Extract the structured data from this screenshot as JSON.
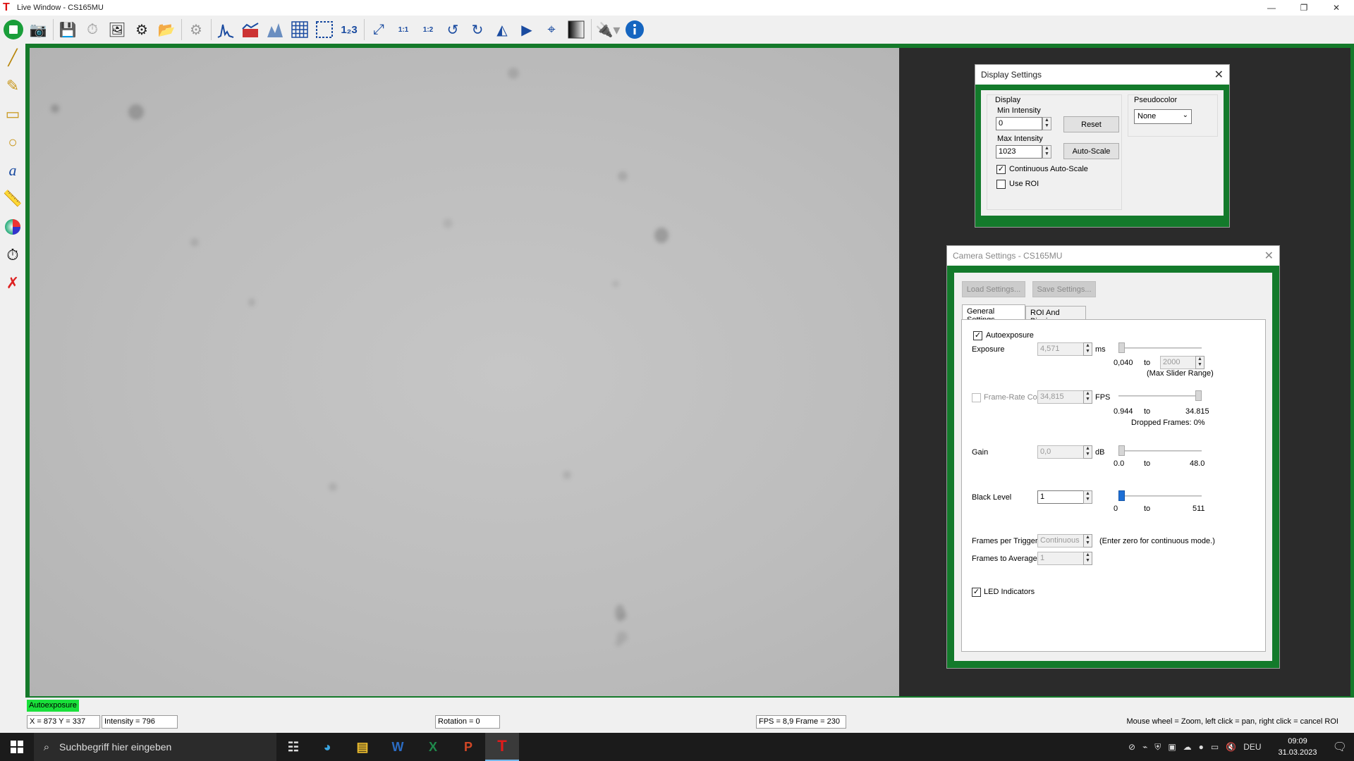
{
  "window": {
    "title": "Live Window - CS165MU",
    "app_icon": "T"
  },
  "toolbar": {
    "icons": [
      "start-stop-icon",
      "snapshot-icon",
      "record-icon",
      "timed-series-icon",
      "save-image-icon",
      "save-settings-icon",
      "open-folder-icon",
      "camera-settings-icon",
      "histogram-icon",
      "line-profile-icon",
      "3d-profile-icon",
      "grid-icon",
      "roi-select-icon",
      "numbering-icon",
      "fit-to-window-icon",
      "zoom-1-1-icon",
      "zoom-1-2-icon",
      "rotate-ccw-icon",
      "rotate-cw-icon",
      "flip-horizontal-icon",
      "flip-vertical-icon",
      "crosshair-icon",
      "grayscale-icon",
      "plugin-icon",
      "info-icon"
    ],
    "zoom_1_1": "1:1",
    "zoom_1_2": "1:2",
    "numbering": "1₂3"
  },
  "left_tools": [
    "line-tool-icon",
    "pencil-tool-icon",
    "rectangle-tool-icon",
    "circle-tool-icon",
    "text-tool-icon",
    "ruler-tool-icon",
    "color-wheel-icon",
    "stopwatch-icon",
    "clear-annotations-icon"
  ],
  "display_settings": {
    "title": "Display Settings",
    "display_group": "Display",
    "min_intensity_label": "Min Intensity",
    "min_intensity_value": "0",
    "reset_label": "Reset",
    "max_intensity_label": "Max Intensity",
    "max_intensity_value": "1023",
    "autoscale_label": "Auto-Scale",
    "continuous_autoscale_label": "Continuous Auto-Scale",
    "continuous_autoscale_checked": true,
    "use_roi_label": "Use ROI",
    "use_roi_checked": false,
    "pseudocolor_label": "Pseudocolor",
    "pseudocolor_value": "None"
  },
  "camera_settings": {
    "title": "Camera Settings - CS165MU",
    "load_settings": "Load Settings...",
    "save_settings": "Save Settings...",
    "tabs": [
      "General Settings",
      "ROI And Binning"
    ],
    "autoexposure_label": "Autoexposure",
    "autoexposure_checked": true,
    "exposure_label": "Exposure",
    "exposure_value": "4,571",
    "exposure_unit": "ms",
    "exposure_min": "0,040",
    "exposure_to": "to",
    "exposure_max": "2000",
    "max_slider_range": "(Max Slider Range)",
    "framerate_label": "Frame-Rate Control",
    "framerate_checked": false,
    "framerate_value": "34,815",
    "framerate_unit": "FPS",
    "framerate_min": "0.944",
    "framerate_to": "to",
    "framerate_max": "34.815",
    "dropped_frames": "Dropped Frames: 0%",
    "gain_label": "Gain",
    "gain_value": "0,0",
    "gain_unit": "dB",
    "gain_min": "0.0",
    "gain_to": "to",
    "gain_max": "48.0",
    "black_level_label": "Black Level",
    "black_level_value": "1",
    "black_min": "0",
    "black_to": "to",
    "black_max": "511",
    "frames_per_trigger_label": "Frames per Trigger",
    "frames_per_trigger_value": "Continuous",
    "frames_per_trigger_hint": "(Enter zero for continuous mode.)",
    "frames_to_average_label": "Frames to Average",
    "frames_to_average_value": "1",
    "led_indicators_label": "LED Indicators",
    "led_indicators_checked": true,
    "exposure_slider_fraction": 0.0,
    "framerate_slider_fraction": 1.0,
    "gain_slider_fraction": 0.0,
    "black_slider_fraction": 0.0
  },
  "status": {
    "badge": "Autoexposure",
    "coords": "X = 873  Y = 337",
    "intensity": "Intensity = 796",
    "rotation": "Rotation = 0",
    "fps_frame": "FPS = 8,9  Frame = 230",
    "hint": "Mouse wheel = Zoom, left click = pan, right click = cancel ROI"
  },
  "taskbar": {
    "search_placeholder": "Suchbegriff hier eingeben",
    "apps": [
      "task-view-icon",
      "edge-icon",
      "file-explorer-icon",
      "word-icon",
      "excel-icon",
      "powerpoint-icon",
      "thorcam-icon"
    ],
    "language": "DEU",
    "time": "09:09",
    "date": "31.03.2023"
  },
  "colors": {
    "frame_green": "#137a2b",
    "badge_green": "#19e03a",
    "accent_blue": "#1a4ba0"
  }
}
